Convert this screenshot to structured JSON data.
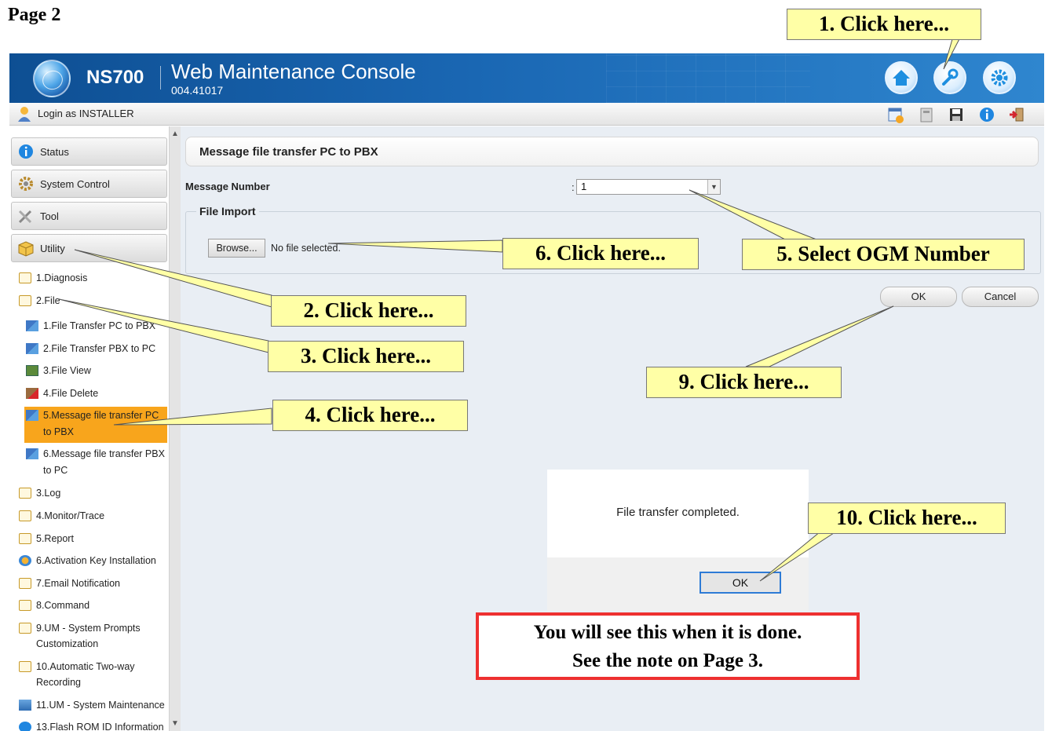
{
  "page_label": "Page 2",
  "header": {
    "model": "NS700",
    "title": "Web Maintenance Console",
    "version": "004.41017"
  },
  "login_bar": {
    "login_text": "Login as INSTALLER"
  },
  "sidebar": {
    "sections": [
      {
        "label": "Status",
        "icon": "info-icon"
      },
      {
        "label": "System Control",
        "icon": "gear-icon"
      },
      {
        "label": "Tool",
        "icon": "tools-icon"
      },
      {
        "label": "Utility",
        "icon": "box-icon"
      }
    ],
    "tree": [
      {
        "label": "1.Diagnosis"
      },
      {
        "label": "2.File"
      },
      {
        "label": "1.File Transfer PC to PBX"
      },
      {
        "label": "2.File Transfer PBX to PC"
      },
      {
        "label": "3.File View"
      },
      {
        "label": "4.File Delete"
      },
      {
        "label": "5.Message file transfer PC to PBX"
      },
      {
        "label": "6.Message file transfer PBX to PC"
      },
      {
        "label": "3.Log"
      },
      {
        "label": "4.Monitor/Trace"
      },
      {
        "label": "5.Report"
      },
      {
        "label": "6.Activation Key Installation"
      },
      {
        "label": "7.Email Notification"
      },
      {
        "label": "8.Command"
      },
      {
        "label": "9.UM - System Prompts Customization"
      },
      {
        "label": "10.Automatic Two-way Recording"
      },
      {
        "label": "11.UM - System Maintenance"
      },
      {
        "label": "13.Flash ROM ID Information"
      }
    ]
  },
  "main": {
    "page_title": "Message file transfer PC to PBX",
    "message_number_label": "Message Number",
    "colon": ":",
    "message_number_value": "1",
    "file_import_legend": "File Import",
    "browse_label": "Browse...",
    "file_status": "No file selected.",
    "ok_label": "OK",
    "cancel_label": "Cancel"
  },
  "dialog": {
    "message": "File transfer completed.",
    "ok_label": "OK"
  },
  "annotations": {
    "step1": "1. Click here...",
    "step2": "2. Click here...",
    "step3": "3. Click here...",
    "step4": "4. Click here...",
    "step5": "5. Select OGM Number",
    "step6": "6. Click here...",
    "step9": "9. Click here...",
    "step10": "10. Click here...",
    "note_line1": "You will see this when it is done.",
    "note_line2": "See the note on Page 3."
  },
  "colors": {
    "header_blue": "#1a67b3",
    "active_orange": "#f8a51c",
    "callout_yellow": "#ffffa6",
    "note_red": "#ee3030",
    "dialog_focus_blue": "#2e7bd6"
  }
}
